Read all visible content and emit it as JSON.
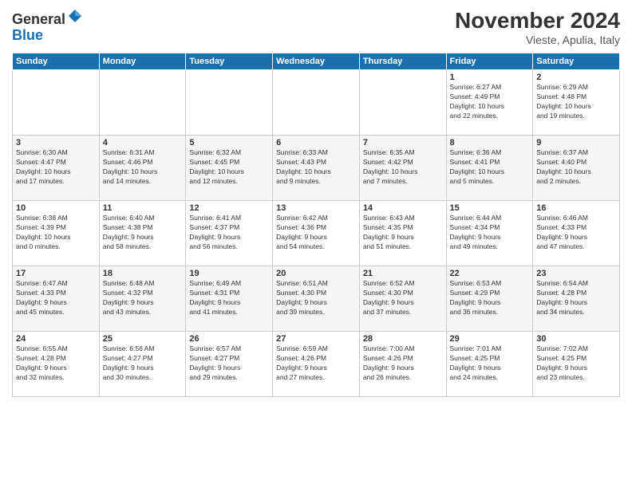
{
  "logo": {
    "general": "General",
    "blue": "Blue"
  },
  "header": {
    "month": "November 2024",
    "location": "Vieste, Apulia, Italy"
  },
  "weekdays": [
    "Sunday",
    "Monday",
    "Tuesday",
    "Wednesday",
    "Thursday",
    "Friday",
    "Saturday"
  ],
  "weeks": [
    [
      {
        "day": "",
        "info": ""
      },
      {
        "day": "",
        "info": ""
      },
      {
        "day": "",
        "info": ""
      },
      {
        "day": "",
        "info": ""
      },
      {
        "day": "",
        "info": ""
      },
      {
        "day": "1",
        "info": "Sunrise: 6:27 AM\nSunset: 4:49 PM\nDaylight: 10 hours\nand 22 minutes."
      },
      {
        "day": "2",
        "info": "Sunrise: 6:29 AM\nSunset: 4:48 PM\nDaylight: 10 hours\nand 19 minutes."
      }
    ],
    [
      {
        "day": "3",
        "info": "Sunrise: 6:30 AM\nSunset: 4:47 PM\nDaylight: 10 hours\nand 17 minutes."
      },
      {
        "day": "4",
        "info": "Sunrise: 6:31 AM\nSunset: 4:46 PM\nDaylight: 10 hours\nand 14 minutes."
      },
      {
        "day": "5",
        "info": "Sunrise: 6:32 AM\nSunset: 4:45 PM\nDaylight: 10 hours\nand 12 minutes."
      },
      {
        "day": "6",
        "info": "Sunrise: 6:33 AM\nSunset: 4:43 PM\nDaylight: 10 hours\nand 9 minutes."
      },
      {
        "day": "7",
        "info": "Sunrise: 6:35 AM\nSunset: 4:42 PM\nDaylight: 10 hours\nand 7 minutes."
      },
      {
        "day": "8",
        "info": "Sunrise: 6:36 AM\nSunset: 4:41 PM\nDaylight: 10 hours\nand 5 minutes."
      },
      {
        "day": "9",
        "info": "Sunrise: 6:37 AM\nSunset: 4:40 PM\nDaylight: 10 hours\nand 2 minutes."
      }
    ],
    [
      {
        "day": "10",
        "info": "Sunrise: 6:38 AM\nSunset: 4:39 PM\nDaylight: 10 hours\nand 0 minutes."
      },
      {
        "day": "11",
        "info": "Sunrise: 6:40 AM\nSunset: 4:38 PM\nDaylight: 9 hours\nand 58 minutes."
      },
      {
        "day": "12",
        "info": "Sunrise: 6:41 AM\nSunset: 4:37 PM\nDaylight: 9 hours\nand 56 minutes."
      },
      {
        "day": "13",
        "info": "Sunrise: 6:42 AM\nSunset: 4:36 PM\nDaylight: 9 hours\nand 54 minutes."
      },
      {
        "day": "14",
        "info": "Sunrise: 6:43 AM\nSunset: 4:35 PM\nDaylight: 9 hours\nand 51 minutes."
      },
      {
        "day": "15",
        "info": "Sunrise: 6:44 AM\nSunset: 4:34 PM\nDaylight: 9 hours\nand 49 minutes."
      },
      {
        "day": "16",
        "info": "Sunrise: 6:46 AM\nSunset: 4:33 PM\nDaylight: 9 hours\nand 47 minutes."
      }
    ],
    [
      {
        "day": "17",
        "info": "Sunrise: 6:47 AM\nSunset: 4:33 PM\nDaylight: 9 hours\nand 45 minutes."
      },
      {
        "day": "18",
        "info": "Sunrise: 6:48 AM\nSunset: 4:32 PM\nDaylight: 9 hours\nand 43 minutes."
      },
      {
        "day": "19",
        "info": "Sunrise: 6:49 AM\nSunset: 4:31 PM\nDaylight: 9 hours\nand 41 minutes."
      },
      {
        "day": "20",
        "info": "Sunrise: 6:51 AM\nSunset: 4:30 PM\nDaylight: 9 hours\nand 39 minutes."
      },
      {
        "day": "21",
        "info": "Sunrise: 6:52 AM\nSunset: 4:30 PM\nDaylight: 9 hours\nand 37 minutes."
      },
      {
        "day": "22",
        "info": "Sunrise: 6:53 AM\nSunset: 4:29 PM\nDaylight: 9 hours\nand 36 minutes."
      },
      {
        "day": "23",
        "info": "Sunrise: 6:54 AM\nSunset: 4:28 PM\nDaylight: 9 hours\nand 34 minutes."
      }
    ],
    [
      {
        "day": "24",
        "info": "Sunrise: 6:55 AM\nSunset: 4:28 PM\nDaylight: 9 hours\nand 32 minutes."
      },
      {
        "day": "25",
        "info": "Sunrise: 6:56 AM\nSunset: 4:27 PM\nDaylight: 9 hours\nand 30 minutes."
      },
      {
        "day": "26",
        "info": "Sunrise: 6:57 AM\nSunset: 4:27 PM\nDaylight: 9 hours\nand 29 minutes."
      },
      {
        "day": "27",
        "info": "Sunrise: 6:59 AM\nSunset: 4:26 PM\nDaylight: 9 hours\nand 27 minutes."
      },
      {
        "day": "28",
        "info": "Sunrise: 7:00 AM\nSunset: 4:26 PM\nDaylight: 9 hours\nand 26 minutes."
      },
      {
        "day": "29",
        "info": "Sunrise: 7:01 AM\nSunset: 4:25 PM\nDaylight: 9 hours\nand 24 minutes."
      },
      {
        "day": "30",
        "info": "Sunrise: 7:02 AM\nSunset: 4:25 PM\nDaylight: 9 hours\nand 23 minutes."
      }
    ]
  ]
}
